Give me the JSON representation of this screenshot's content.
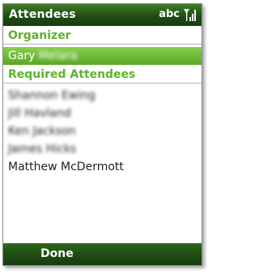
{
  "title": "Attendees",
  "status": {
    "input_mode": "abc",
    "signal_icon": "signal-strength-icon"
  },
  "organizer_header": "Organizer",
  "organizer": {
    "first": "Gary",
    "last": "Melara"
  },
  "required_header": "Required Attendees",
  "attendees": [
    "Shannon Ewing",
    "Jill Havland",
    "Ken Jackson",
    "James Hicks",
    "Matthew McDermott"
  ],
  "softkey_left": "Done",
  "colors": {
    "titlebar": "#1f4d13",
    "accent_green": "#5db32d",
    "selection_green": "#6fbf36"
  }
}
